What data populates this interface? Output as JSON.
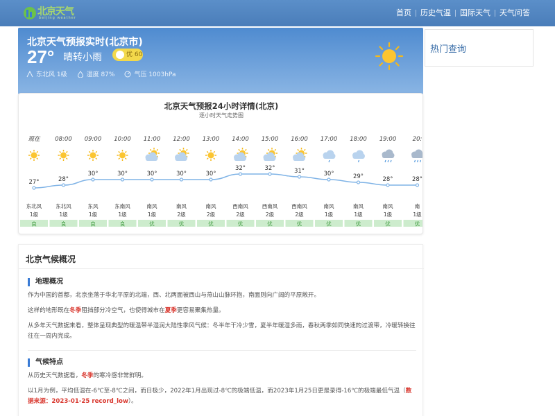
{
  "header": {
    "logo_text": "北京天气",
    "logo_sub": "beijing weather",
    "nav": [
      "首页",
      "历史气温",
      "国际天气",
      "天气问答"
    ]
  },
  "current": {
    "title": "北京天气预报实时(北京市)",
    "temp": "27°",
    "condition": "晴转小雨",
    "aqi_label": "优 60",
    "wind": "东北风 1级",
    "humidity": "湿度 87%",
    "pressure": "气压 1003hPa"
  },
  "hot": {
    "title": "热门查询"
  },
  "forecast": {
    "title": "北京天气预报24小时详情(北京)",
    "subtitle": "逐小时天气走势图",
    "hours": [
      {
        "time": "现在",
        "icon": "sun-icon",
        "temp": 27,
        "wind_dir": "东北风",
        "wind_lvl": "1级",
        "aqi": "良"
      },
      {
        "time": "08:00",
        "icon": "sun-icon",
        "temp": 28,
        "wind_dir": "东北风",
        "wind_lvl": "1级",
        "aqi": "良"
      },
      {
        "time": "09:00",
        "icon": "sun-icon",
        "temp": 30,
        "wind_dir": "东风",
        "wind_lvl": "1级",
        "aqi": "良"
      },
      {
        "time": "10:00",
        "icon": "sun-icon",
        "temp": 30,
        "wind_dir": "东南风",
        "wind_lvl": "1级",
        "aqi": "良"
      },
      {
        "time": "11:00",
        "icon": "partly-cloudy-icon",
        "temp": 30,
        "wind_dir": "南风",
        "wind_lvl": "1级",
        "aqi": "优"
      },
      {
        "time": "12:00",
        "icon": "partly-cloudy-icon",
        "temp": 30,
        "wind_dir": "南风",
        "wind_lvl": "2级",
        "aqi": "优"
      },
      {
        "time": "13:00",
        "icon": "sun-icon",
        "temp": 30,
        "wind_dir": "南风",
        "wind_lvl": "2级",
        "aqi": "优"
      },
      {
        "time": "14:00",
        "icon": "partly-cloudy-icon",
        "temp": 32,
        "wind_dir": "西南风",
        "wind_lvl": "2级",
        "aqi": "优"
      },
      {
        "time": "15:00",
        "icon": "partly-cloudy-icon",
        "temp": 32,
        "wind_dir": "西南风",
        "wind_lvl": "2级",
        "aqi": "优"
      },
      {
        "time": "16:00",
        "icon": "partly-cloudy-icon",
        "temp": 31,
        "wind_dir": "西南风",
        "wind_lvl": "2级",
        "aqi": "优"
      },
      {
        "time": "17:00",
        "icon": "light-rain-icon",
        "temp": 30,
        "wind_dir": "南风",
        "wind_lvl": "1级",
        "aqi": "优"
      },
      {
        "time": "18:00",
        "icon": "light-rain-icon",
        "temp": 29,
        "wind_dir": "南风",
        "wind_lvl": "1级",
        "aqi": "优"
      },
      {
        "time": "19:00",
        "icon": "rain-icon",
        "temp": 28,
        "wind_dir": "南风",
        "wind_lvl": "1级",
        "aqi": "优"
      },
      {
        "time": "20:",
        "icon": "rain-icon",
        "temp": 28,
        "wind_dir": "南",
        "wind_lvl": "1级",
        "aqi": "优"
      }
    ],
    "colors": {
      "line": "#7fb3e6",
      "good": "#cdeccd",
      "good_text": "#3d9a3d"
    }
  },
  "overview": {
    "title": "北京气候概况",
    "geo_heading": "地理概况",
    "geo_p1": "作为中国的首都，北京坐落于华北平原的北端，西、北两面被西山与燕山山脉环抱，南面则向广阔的平原敞开。",
    "geo_p2_a": "这样的地形既在",
    "geo_p2_h1": "冬季",
    "geo_p2_b": "阻挡部分冷空气，也使得城市在",
    "geo_p2_h2": "夏季",
    "geo_p2_c": "更容易聚集热量。",
    "geo_p3": "从多年天气数据来看，整体呈现典型的暖温带半湿润大陆性季风气候：冬半年干冷少雪，夏半年暖湿多雨，春秋两季如同快速的过渡带，冷暖转换往往在一周内完成。",
    "clim_heading": "气候特点",
    "clim_p1_a": "从历史天气数据看，",
    "clim_p1_h": "冬季",
    "clim_p1_b": "的寒冷感非常鲜明。",
    "clim_p2_a": "以1月为例，平均低温在-6℃至-8℃之间，而日极少，2022年1月出现过-8℃的极端低温，而2023年1月25日更是录得-16℃的极端最低气温（",
    "clim_p2_h": "数据来源：2023-01-25 record_low",
    "clim_p2_b": "）。"
  }
}
